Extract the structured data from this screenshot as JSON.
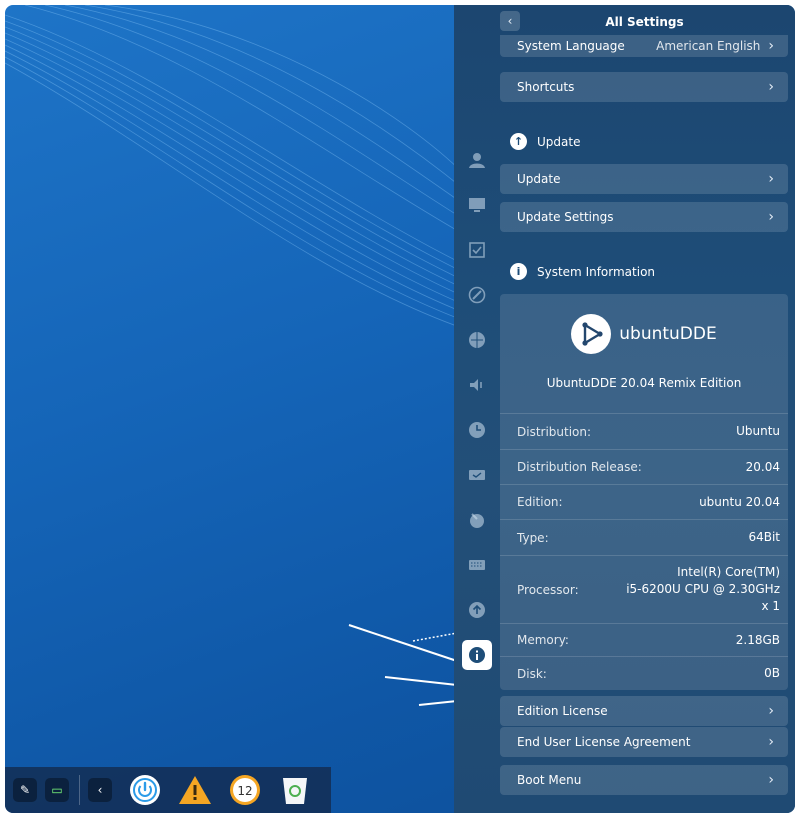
{
  "header": {
    "title": "All Settings"
  },
  "rows": {
    "system_language": {
      "label": "System Language",
      "value": "American English"
    },
    "shortcuts": {
      "label": "Shortcuts"
    },
    "update_section": "Update",
    "update": {
      "label": "Update"
    },
    "update_settings": {
      "label": "Update Settings"
    },
    "sysinfo_section": "System Information",
    "edition_license": {
      "label": "Edition License"
    },
    "eula": {
      "label": "End User License Agreement"
    },
    "boot_menu": {
      "label": "Boot Menu"
    }
  },
  "system_info": {
    "logo_text": "ubuntuDDE",
    "edition_name": "UbuntuDDE 20.04 Remix Edition",
    "distribution": {
      "k": "Distribution:",
      "v": "Ubuntu"
    },
    "release": {
      "k": "Distribution Release:",
      "v": "20.04"
    },
    "edition": {
      "k": "Edition:",
      "v": "ubuntu 20.04"
    },
    "type": {
      "k": "Type:",
      "v": "64Bit"
    },
    "processor": {
      "k": "Processor:",
      "v1": "Intel(R) Core(TM)",
      "v2": "i5-6200U CPU @ 2.30GHz",
      "v3": "x 1"
    },
    "memory": {
      "k": "Memory:",
      "v": "2.18GB"
    },
    "disk": {
      "k": "Disk:",
      "v": "0B"
    }
  },
  "sidebar": {
    "icons": [
      "accounts-icon",
      "display-icon",
      "default-apps-icon",
      "personalization-icon",
      "network-icon",
      "sound-icon",
      "datetime-icon",
      "power-icon",
      "mouse-icon",
      "keyboard-icon",
      "update-icon",
      "system-info-icon"
    ]
  },
  "dock": {
    "apps": [
      "power-app-icon",
      "warning-app-icon",
      "clock-app-icon",
      "trash-app-icon"
    ]
  },
  "colors": {
    "panel": "#1e4d78",
    "desktop": "#1565b8",
    "dock": "#142c50"
  }
}
